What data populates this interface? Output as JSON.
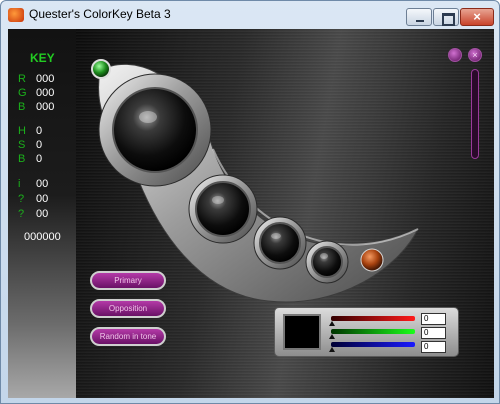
{
  "window": {
    "title": "Quester's ColorKey Beta 3",
    "controls": {
      "close_glyph": "×"
    }
  },
  "key_panel": {
    "title": "KEY",
    "rgb": [
      {
        "label": "R",
        "value": "000"
      },
      {
        "label": "G",
        "value": "000"
      },
      {
        "label": "B",
        "value": "000"
      }
    ],
    "hsb": [
      {
        "label": "H",
        "value": "0"
      },
      {
        "label": "S",
        "value": "0"
      },
      {
        "label": "B",
        "value": "0"
      }
    ],
    "extra": [
      {
        "label": "i",
        "value": "00"
      },
      {
        "label": "?",
        "value": "00"
      },
      {
        "label": "?",
        "value": "00"
      }
    ],
    "hex": "000000"
  },
  "top_right": {
    "close_glyph": "×"
  },
  "buttons": {
    "primary": "Primary",
    "opposition": "Opposition",
    "random": "Random in tone"
  },
  "mixer": {
    "swatch_color": "#000000",
    "red_value": "0",
    "green_value": "0",
    "blue_value": "0"
  },
  "colors": {
    "key_label": "#1bb01b",
    "button_accent": "#8a1f84",
    "indicator_green": "#2fae2f",
    "indicator_orange": "#b4471a"
  }
}
